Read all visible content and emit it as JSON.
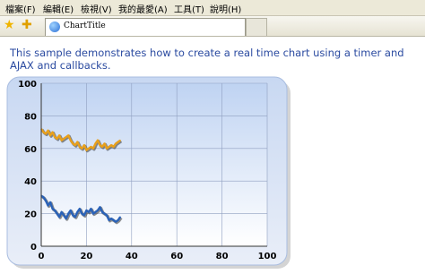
{
  "menu": [
    "檔案(F)",
    "編輯(E)",
    "檢視(V)",
    "我的最愛(A)",
    "工具(T)",
    "說明(H)"
  ],
  "tab": {
    "title": "ChartTitle"
  },
  "description": "This sample demonstrates how to create a real time chart using a timer and AJAX and callbacks.",
  "chart_data": {
    "type": "line",
    "xlim": [
      0,
      100
    ],
    "ylim": [
      0,
      100
    ],
    "x_ticks": [
      0,
      20,
      40,
      60,
      80,
      100
    ],
    "y_ticks": [
      0,
      20,
      40,
      60,
      80,
      100
    ],
    "grid": true,
    "series": [
      {
        "color": "#e8a01c",
        "x": [
          0,
          1,
          2,
          3,
          4,
          5,
          6,
          7,
          8,
          9,
          10,
          11,
          12,
          13,
          14,
          15,
          16,
          17,
          18,
          19,
          20,
          21,
          22,
          23,
          24,
          25,
          26,
          27,
          28,
          29,
          30,
          31,
          32,
          33,
          34,
          35
        ],
        "y": [
          72,
          70,
          69,
          71,
          68,
          70,
          67,
          66,
          68,
          65,
          66,
          67,
          68,
          65,
          63,
          62,
          64,
          61,
          60,
          62,
          59,
          60,
          61,
          60,
          63,
          65,
          62,
          61,
          63,
          60,
          61,
          62,
          61,
          63,
          64,
          65
        ]
      },
      {
        "color": "#2a62b8",
        "x": [
          0,
          1,
          2,
          3,
          4,
          5,
          6,
          7,
          8,
          9,
          10,
          11,
          12,
          13,
          14,
          15,
          16,
          17,
          18,
          19,
          20,
          21,
          22,
          23,
          24,
          25,
          26,
          27,
          28,
          29,
          30,
          31,
          32,
          33,
          34,
          35
        ],
        "y": [
          31,
          30,
          28,
          25,
          27,
          23,
          22,
          20,
          18,
          21,
          19,
          17,
          20,
          22,
          19,
          18,
          21,
          23,
          20,
          19,
          22,
          21,
          23,
          20,
          21,
          22,
          24,
          21,
          20,
          19,
          16,
          17,
          16,
          15,
          16,
          18
        ]
      }
    ]
  }
}
